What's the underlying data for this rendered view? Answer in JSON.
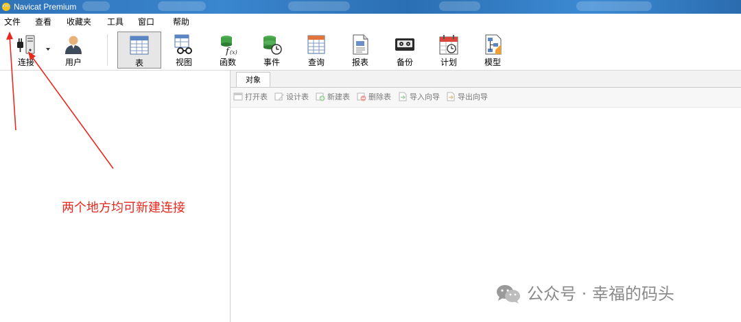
{
  "window": {
    "title": "Navicat Premium"
  },
  "menubar": {
    "items": [
      "文件",
      "查看",
      "收藏夹",
      "工具",
      "窗口",
      "帮助"
    ]
  },
  "toolbar": {
    "connect_label": "连接",
    "user_label": "用户",
    "table_label": "表",
    "view_label": "视图",
    "function_label": "函数",
    "event_label": "事件",
    "query_label": "查询",
    "report_label": "报表",
    "backup_label": "备份",
    "schedule_label": "计划",
    "model_label": "模型",
    "active_tool": "表"
  },
  "objects_panel": {
    "tab_label": "对象",
    "actions": [
      "打开表",
      "设计表",
      "新建表",
      "删除表",
      "导入向导",
      "导出向导"
    ]
  },
  "annotation": {
    "text": "两个地方均可新建连接",
    "color": "#e8281c"
  },
  "watermark": {
    "text": "公众号 · 幸福的码头"
  }
}
